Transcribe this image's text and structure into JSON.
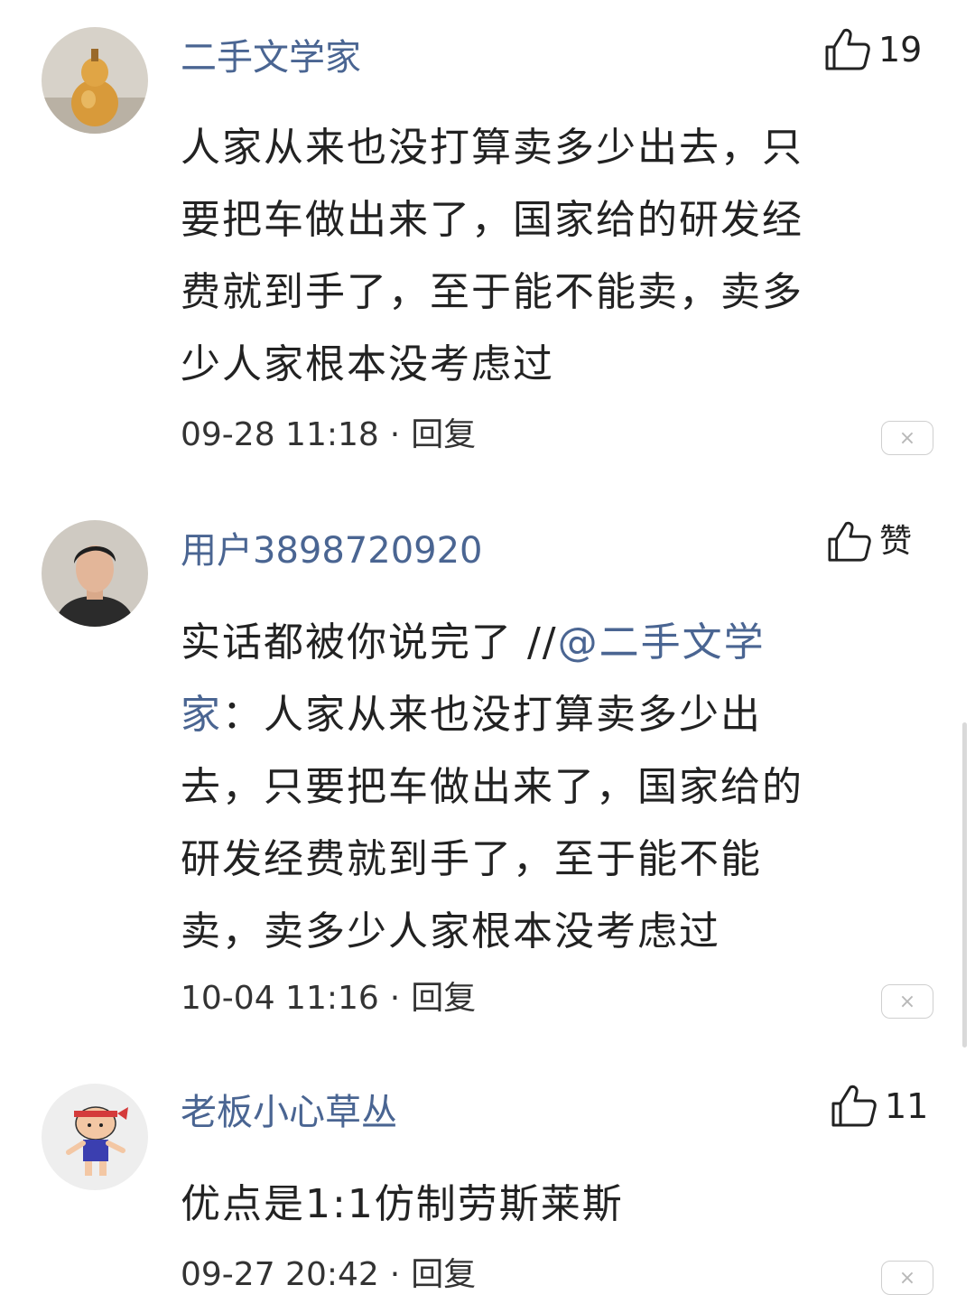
{
  "comments": [
    {
      "username": "二手文学家",
      "likes": "19",
      "lines": [
        "人家从来也没打算卖多少出去，只",
        "要把车做出来了，国家给的研发经",
        "费就到手了，至于能不能卖，卖多",
        "少人家根本没考虑过"
      ],
      "time": "09-28 11:18",
      "reply": "回复",
      "close": "×"
    },
    {
      "username": "用户3898720920",
      "likes": "赞",
      "line1_text": "实话都被你说完了 //",
      "line1_mention": "@二手文学",
      "line2_mention": "家",
      "line2_text": "：人家从来也没打算卖多少出",
      "lines": [
        "去，只要把车做出来了，国家给的",
        "研发经费就到手了，至于能不能",
        "卖，卖多少人家根本没考虑过"
      ],
      "time": "10-04 11:16",
      "reply": "回复",
      "close": "×"
    },
    {
      "username": "老板小心草丛",
      "likes": "11",
      "lines": [
        "优点是1:1仿制劳斯莱斯"
      ],
      "time": "09-27 20:42",
      "reply": "回复",
      "close": "×"
    }
  ],
  "icons": {
    "like": "thumbs-up-icon",
    "close": "close-icon"
  },
  "colors": {
    "username": "#4a6592",
    "text": "#222222",
    "meta": "#333333"
  }
}
